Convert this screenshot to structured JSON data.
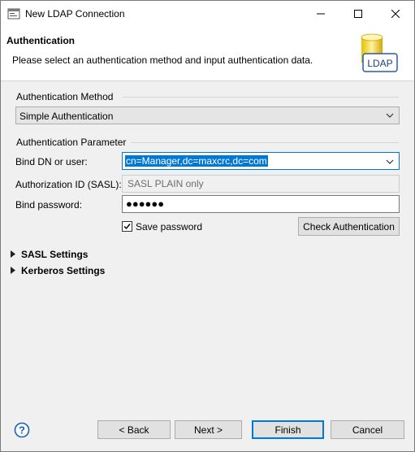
{
  "window": {
    "title": "New LDAP Connection",
    "controls": [
      "minimize",
      "maximize",
      "close"
    ]
  },
  "header": {
    "title": "Authentication",
    "description": "Please select an authentication method and input authentication data.",
    "icon_label": "LDAP"
  },
  "auth_method": {
    "group_label": "Authentication Method",
    "selected": "Simple Authentication"
  },
  "auth_param": {
    "group_label": "Authentication Parameter",
    "bind_dn_label": "Bind DN or user:",
    "bind_dn_value": "cn=Manager,dc=maxcrc,dc=com",
    "authz_id_label": "Authorization ID (SASL):",
    "authz_id_value": "SASL PLAIN only",
    "password_label": "Bind password:",
    "password_value": "●●●●●●",
    "save_password_label": "Save password",
    "save_password_checked": true,
    "check_auth_button": "Check Authentication"
  },
  "sections": {
    "sasl": "SASL Settings",
    "kerberos": "Kerberos Settings"
  },
  "footer": {
    "back": "< Back",
    "next": "Next >",
    "finish": "Finish",
    "cancel": "Cancel"
  }
}
